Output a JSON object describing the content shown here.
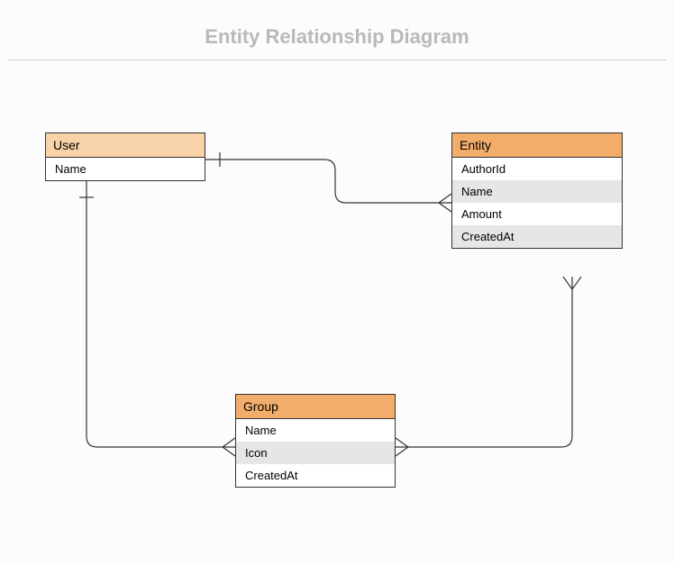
{
  "title": "Entity Relationship Diagram",
  "entities": {
    "user": {
      "name": "User",
      "attributes": [
        "Name"
      ]
    },
    "entity": {
      "name": "Entity",
      "attributes": [
        "AuthorId",
        "Name",
        "Amount",
        "CreatedAt"
      ]
    },
    "group": {
      "name": "Group",
      "attributes": [
        "Name",
        "Icon",
        "CreatedAt"
      ]
    }
  },
  "relationships": [
    {
      "from": "User",
      "to": "Entity",
      "from_card": "one",
      "to_card": "many"
    },
    {
      "from": "User",
      "to": "Group",
      "from_card": "one",
      "to_card": "many"
    },
    {
      "from": "Entity",
      "to": "Group",
      "from_card": "many",
      "to_card": "many"
    }
  ]
}
